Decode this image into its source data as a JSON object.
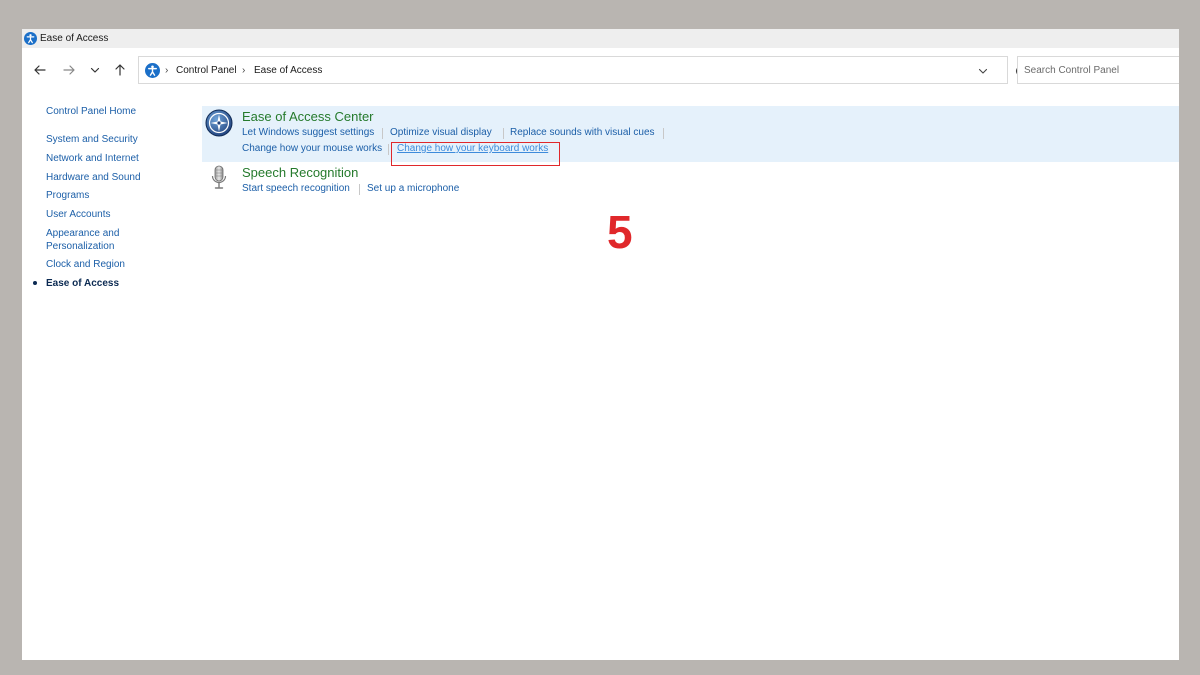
{
  "window": {
    "title": "Ease of Access",
    "title_icon": "ease-of-access-icon"
  },
  "nav": {
    "back_icon": "back-arrow-icon",
    "forward_icon": "forward-arrow-icon",
    "recent_icon": "chevron-down-icon",
    "up_icon": "up-arrow-icon"
  },
  "address": {
    "icon": "ease-of-access-icon",
    "breadcrumbs": [
      "Control Panel",
      "Ease of Access"
    ],
    "separator": "›"
  },
  "search": {
    "placeholder": "Search Control Panel",
    "value": ""
  },
  "sidebar": {
    "items": [
      {
        "label": "Control Panel Home"
      },
      {
        "label": "System and Security"
      },
      {
        "label": "Network and Internet"
      },
      {
        "label": "Hardware and Sound"
      },
      {
        "label": "Programs"
      },
      {
        "label": "User Accounts"
      },
      {
        "label": "Appearance and"
      },
      {
        "label": "Personalization"
      },
      {
        "label": "Clock and Region"
      },
      {
        "label": "Ease of Access"
      }
    ],
    "current": "Ease of Access"
  },
  "categories": [
    {
      "title": "Ease of Access Center",
      "icon": "ease-of-access-center-icon",
      "links": [
        "Let Windows suggest settings",
        "Optimize visual display",
        "Replace sounds with visual cues",
        "Change how your mouse works",
        "Change how your keyboard works"
      ]
    },
    {
      "title": "Speech Recognition",
      "icon": "microphone-icon",
      "links": [
        "Start speech recognition",
        "Set up a microphone"
      ]
    }
  ],
  "annotation": {
    "step": "5",
    "color": "#e0282b"
  },
  "colors": {
    "link": "#1c5fa8",
    "category_title": "#257a2c",
    "highlight": "#e5f1fb"
  }
}
